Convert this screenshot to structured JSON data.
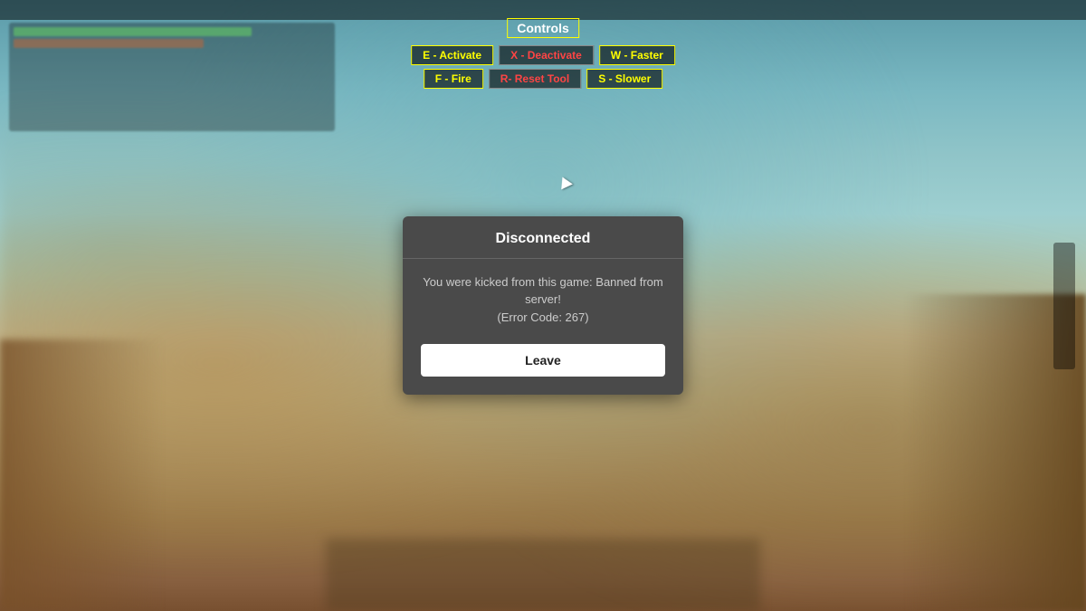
{
  "topBar": {
    "visible": true
  },
  "controls": {
    "title": "Controls",
    "buttons": [
      {
        "key": "E",
        "label": "E - Activate",
        "style": "yellow"
      },
      {
        "key": "X",
        "label": "X - Deactivate",
        "style": "red"
      },
      {
        "key": "W",
        "label": "W - Faster",
        "style": "yellow"
      },
      {
        "key": "F",
        "label": "F - Fire",
        "style": "yellow"
      },
      {
        "key": "R",
        "label": "R- Reset Tool",
        "style": "red"
      },
      {
        "key": "S",
        "label": "S - Slower",
        "style": "yellow"
      }
    ]
  },
  "modal": {
    "title": "Disconnected",
    "message": "You were kicked from this game: Banned from server!\n(Error Code: 267)",
    "message_line1": "You were kicked from this game: Banned from",
    "message_line2": "server!",
    "message_line3": "(Error Code: 267)",
    "leave_button": "Leave"
  }
}
